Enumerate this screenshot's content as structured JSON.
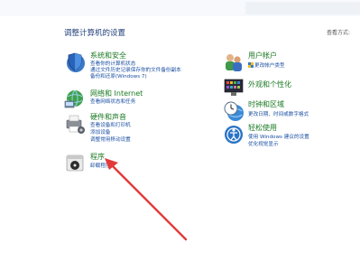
{
  "header": {
    "title": "调整计算机的设置",
    "view_by": "查看方式:"
  },
  "categories_left": [
    {
      "name": "system-security",
      "title": "系统和安全",
      "links": [
        "查看你的计算机状态",
        "通过文件历史记录保存你的文件备份副本",
        "备份和还原(Windows 7)"
      ],
      "icon": "shield-icon"
    },
    {
      "name": "network-internet",
      "title": "网络和 Internet",
      "links": [
        "查看网络状态和任务"
      ],
      "icon": "network-globe-icon"
    },
    {
      "name": "hardware-sound",
      "title": "硬件和声音",
      "links": [
        "查看设备和打印机",
        "添加设备",
        "调整常用移动设置"
      ],
      "icon": "printer-speaker-icon"
    },
    {
      "name": "programs",
      "title": "程序",
      "links": [
        "卸载程序"
      ],
      "icon": "programs-disc-icon"
    }
  ],
  "categories_right": [
    {
      "name": "user-accounts",
      "title": "用户帐户",
      "links": [
        "更改帐户类型"
      ],
      "icon": "users-icon"
    },
    {
      "name": "appearance",
      "title": "外观和个性化",
      "links": [],
      "icon": "display-palette-icon"
    },
    {
      "name": "clock-region",
      "title": "时钟和区域",
      "links": [
        "更改日期、时间或数字格式"
      ],
      "icon": "clock-globe-icon"
    },
    {
      "name": "ease-of-access",
      "title": "轻松使用",
      "links": [
        "使用 Windows 建议的设置",
        "优化视觉显示"
      ],
      "icon": "ease-of-access-icon"
    }
  ],
  "colors": {
    "heading_green": "#1b7a23",
    "link_blue": "#1a4fa3",
    "arrow_red": "#e23a3a"
  }
}
